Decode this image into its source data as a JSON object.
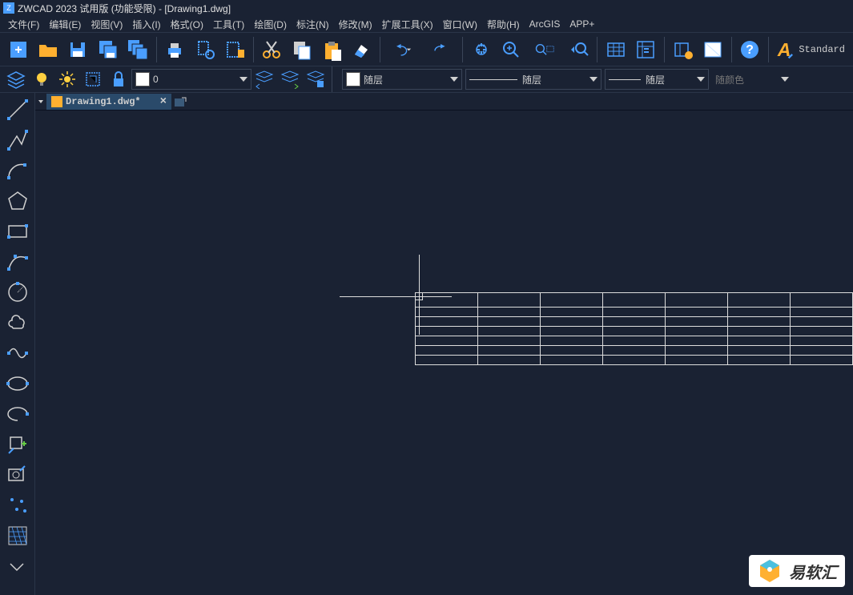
{
  "title": "ZWCAD 2023 试用版 (功能受限) - [Drawing1.dwg]",
  "menus": [
    "文件(F)",
    "编辑(E)",
    "视图(V)",
    "插入(I)",
    "格式(O)",
    "工具(T)",
    "绘图(D)",
    "标注(N)",
    "修改(M)",
    "扩展工具(X)",
    "窗口(W)",
    "帮助(H)",
    "ArcGIS",
    "APP+"
  ],
  "layer": {
    "current": "0",
    "linetype_label": "随层",
    "lineweight_label": "随层",
    "plotstyle_label": "随层",
    "color_label": "随颜色"
  },
  "text_style": "Standard",
  "document_tab": "Drawing1.dwg*",
  "watermark": "易软汇",
  "chart_data": {
    "type": "table",
    "description": "Empty CAD drawing canvas with a drawn table grid",
    "rows": 7,
    "cols": 7,
    "cells_empty": true
  }
}
